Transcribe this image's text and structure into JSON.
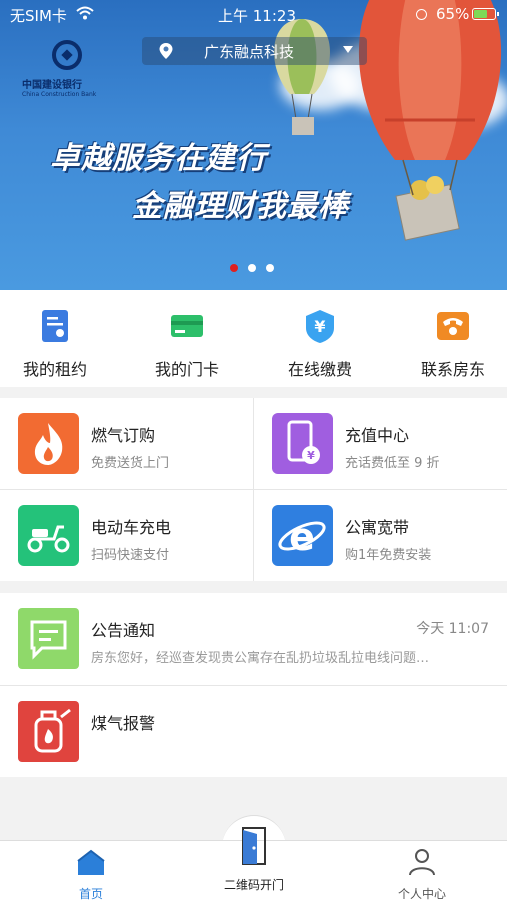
{
  "status_bar": {
    "carrier": "无SIM卡",
    "time": "上午 11:23",
    "battery": "65%",
    "battery_level": 0.65
  },
  "location": {
    "city": "广东融点科技"
  },
  "banner": {
    "bank_name_cn": "中国建设银行",
    "bank_name_en": "China Construction Bank",
    "slogan_line1": "卓越服务在建行",
    "slogan_line2": "金融理财我最棒",
    "active_slide": 0,
    "slide_count": 3
  },
  "quick_actions": [
    {
      "label": "我的租约",
      "icon": "contract-icon",
      "color": "#3b7be0"
    },
    {
      "label": "我的门卡",
      "icon": "door-card-icon",
      "color": "#2dbf6a"
    },
    {
      "label": "在线缴费",
      "icon": "yen-payment-icon",
      "color": "#3aa3f0"
    },
    {
      "label": "联系房东",
      "icon": "phone-icon",
      "color": "#f08a24"
    }
  ],
  "services": [
    {
      "title": "燃气订购",
      "subtitle": "免费送货上门",
      "icon": "flame-icon",
      "color": "#f26b32"
    },
    {
      "title": "充值中心",
      "subtitle": "充话费低至 9 折",
      "icon": "mobile-recharge-icon",
      "color": "#a05ee0"
    },
    {
      "title": "电动车充电",
      "subtitle": "扫码快速支付",
      "icon": "scooter-icon",
      "color": "#24c27a"
    },
    {
      "title": "公寓宽带",
      "subtitle": "购1年免费安装",
      "icon": "browser-e-icon",
      "color": "#2f7fe0"
    }
  ],
  "notices": [
    {
      "title": "公告通知",
      "time": "今天 11:07",
      "body": "房东您好，经巡查发现贵公寓存在乱扔垃圾乱拉电线问题…",
      "icon": "message-icon",
      "color": "#8fd96a"
    },
    {
      "title": "煤气报警",
      "time": "",
      "body": "",
      "icon": "gas-alarm-icon",
      "color": "#e0443e"
    }
  ],
  "tabbar": {
    "home": "首页",
    "qr_open": "二维码开门",
    "profile": "个人中心",
    "active_color": "#2b7fd9"
  }
}
